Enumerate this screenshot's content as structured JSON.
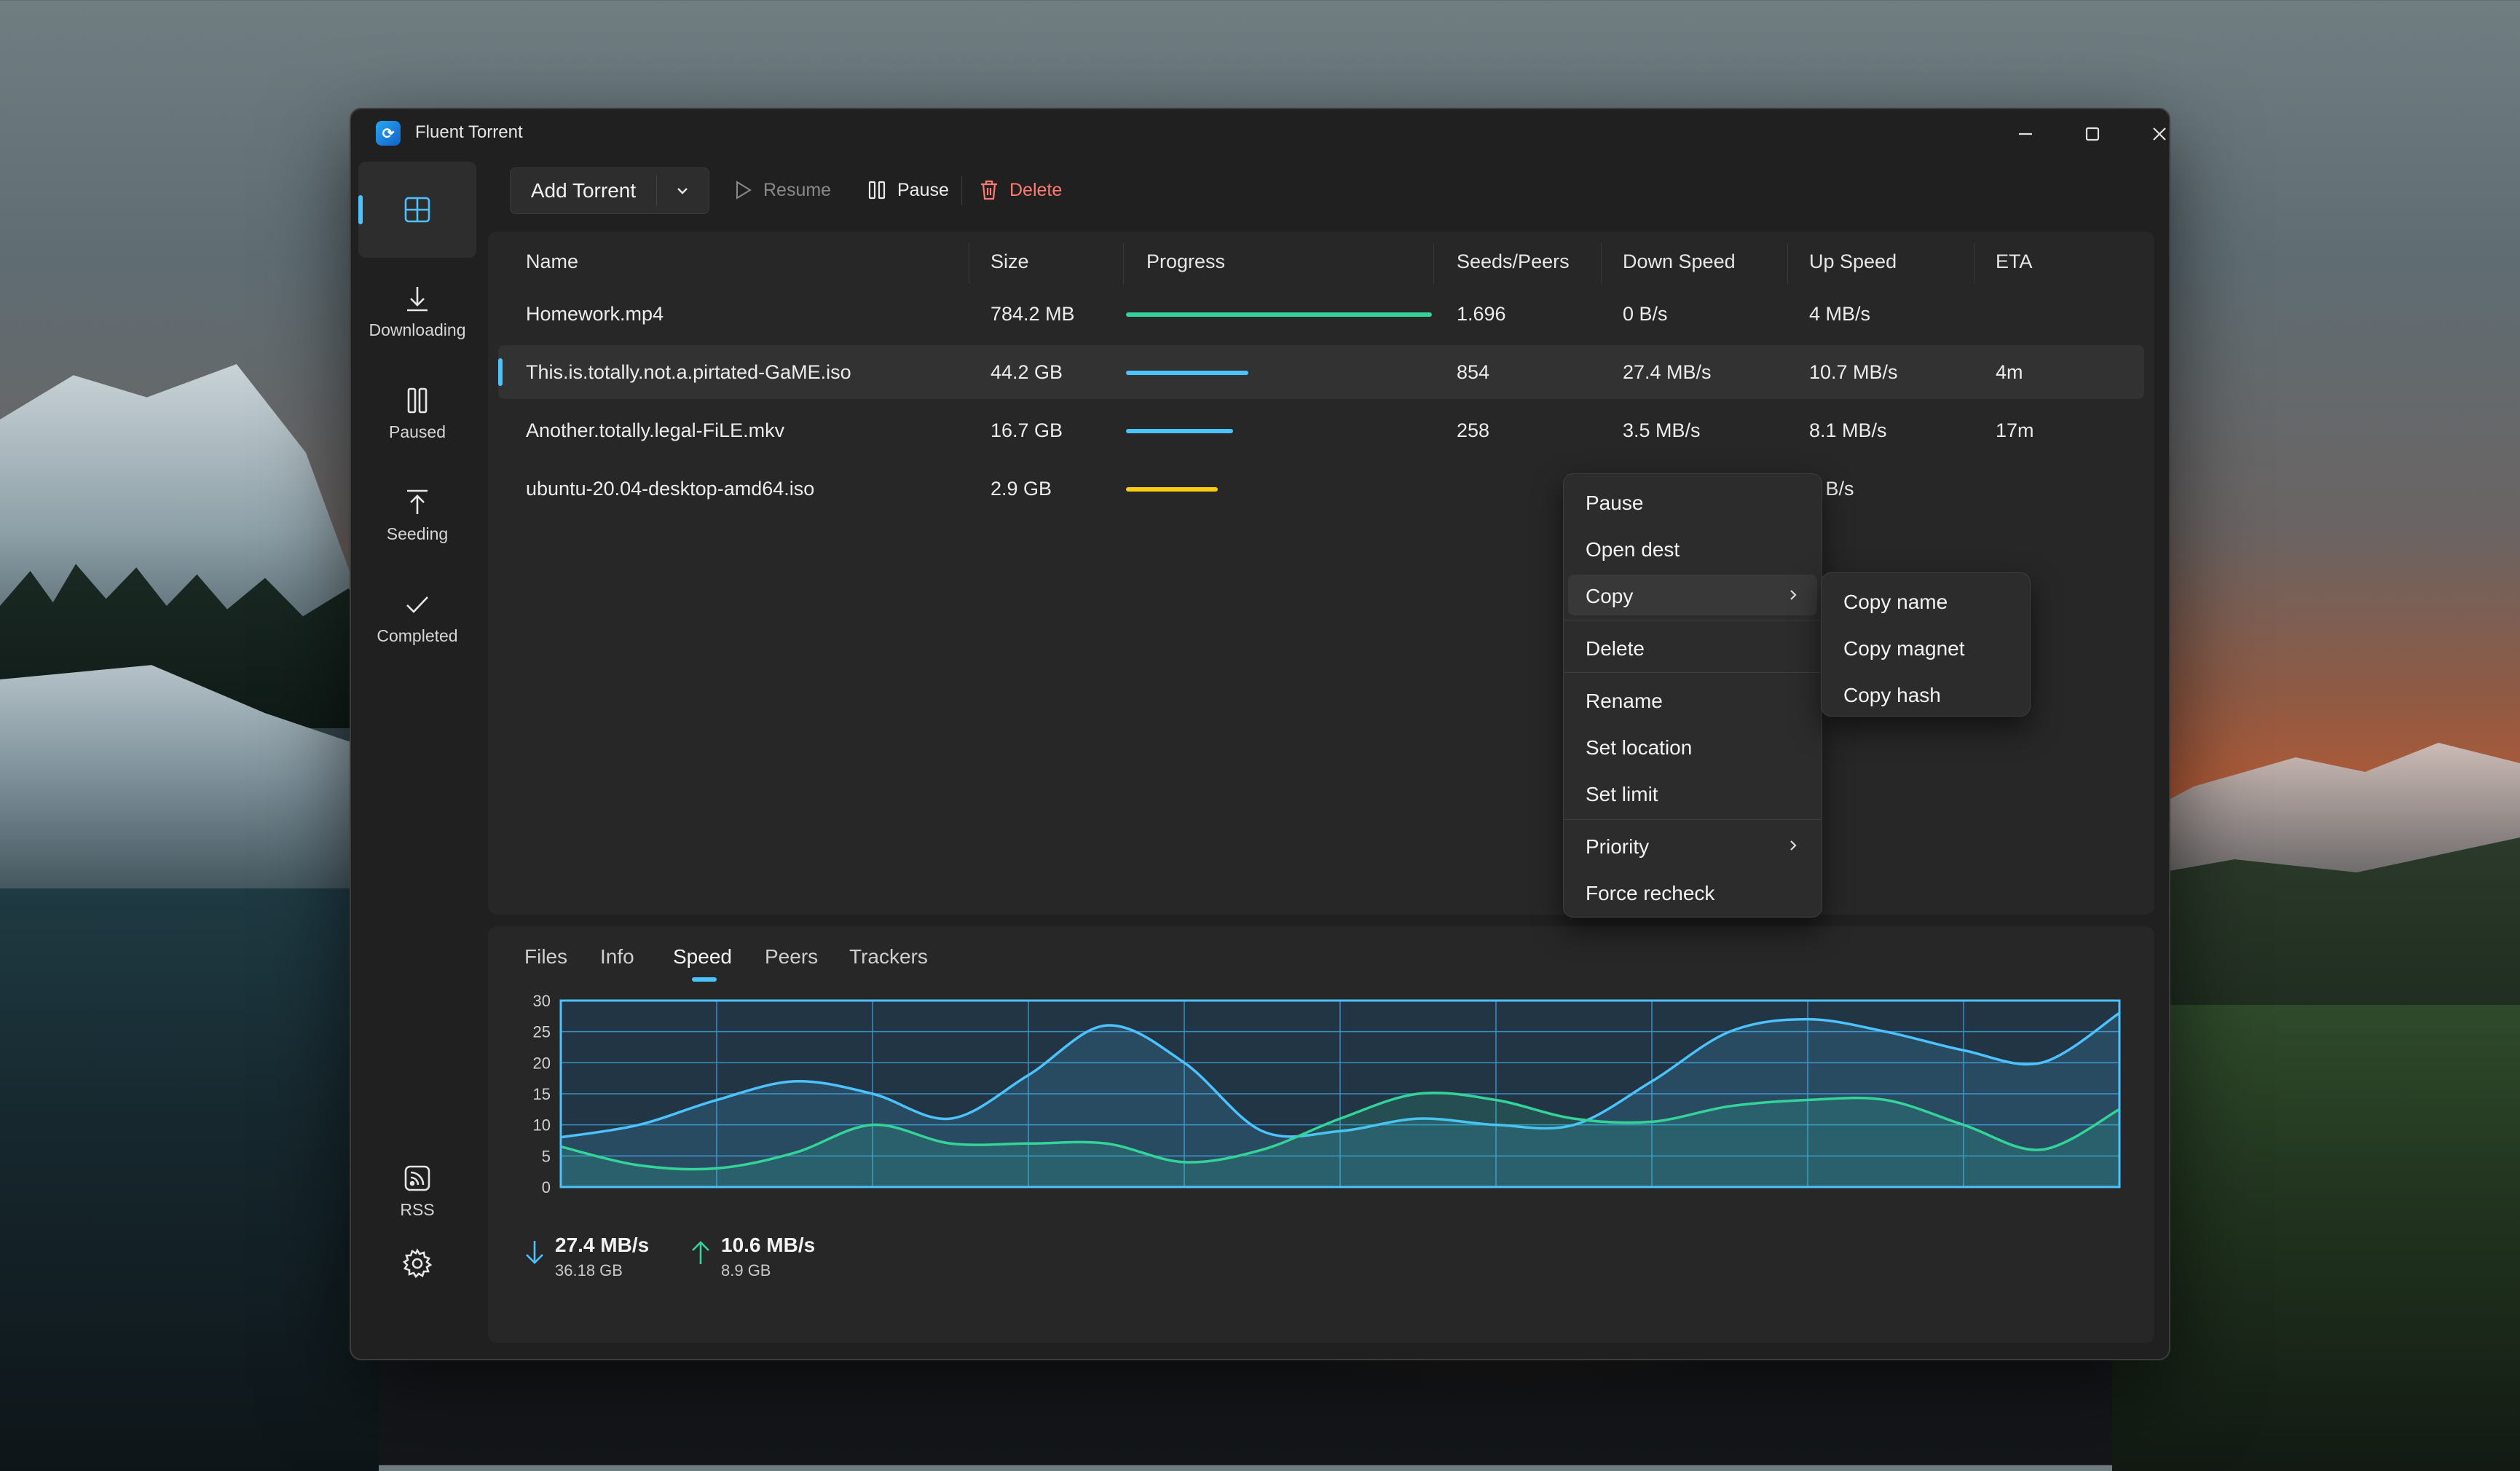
{
  "window": {
    "title": "Fluent Torrent"
  },
  "sidebar": {
    "items": [
      {
        "label": "",
        "icon": "grid-icon"
      },
      {
        "label": "Downloading",
        "icon": "download-icon"
      },
      {
        "label": "Paused",
        "icon": "pause-icon"
      },
      {
        "label": "Seeding",
        "icon": "upload-icon"
      },
      {
        "label": "Completed",
        "icon": "checkmark-icon"
      }
    ],
    "rss_label": "RSS",
    "settings_icon": "gear-icon"
  },
  "toolbar": {
    "add_torrent": "Add Torrent",
    "resume": "Resume",
    "pause": "Pause",
    "delete": "Delete"
  },
  "table": {
    "columns": [
      "Name",
      "Size",
      "Progress",
      "Seeds/Peers",
      "Down Speed",
      "Up Speed",
      "ETA"
    ],
    "rows": [
      {
        "name": "Homework.mp4",
        "size": "784.2 MB",
        "progress": 1.0,
        "color": "#34d399",
        "seeds_peers": "1.696",
        "down": "0 B/s",
        "up": "4 MB/s",
        "eta": ""
      },
      {
        "name": "This.is.totally.not.a.pirtated-GaME.iso",
        "size": "44.2 GB",
        "progress": 0.4,
        "color": "#4cc2ff",
        "seeds_peers": "854",
        "down": "27.4 MB/s",
        "up": "10.7 MB/s",
        "eta": "4m"
      },
      {
        "name": "Another.totally.legal-FiLE.mkv",
        "size": "16.7 GB",
        "progress": 0.35,
        "color": "#4cc2ff",
        "seeds_peers": "258",
        "down": "3.5 MB/s",
        "up": "8.1 MB/s",
        "eta": "17m"
      },
      {
        "name": "ubuntu-20.04-desktop-amd64.iso",
        "size": "2.9 GB",
        "progress": 0.3,
        "color": "#facc15",
        "seeds_peers": "",
        "down": "",
        "up": "0 B/s",
        "eta": ""
      }
    ]
  },
  "context_menu": {
    "items": [
      "Pause",
      "Open dest",
      "Copy",
      "Delete",
      "Rename",
      "Set location",
      "Set limit",
      "Priority",
      "Force recheck"
    ],
    "copy_submenu": [
      "Copy name",
      "Copy magnet",
      "Copy hash"
    ]
  },
  "details": {
    "tabs": [
      "Files",
      "Info",
      "Speed",
      "Peers",
      "Trackers"
    ],
    "active_tab": "Speed",
    "download": {
      "speed": "27.4 MB/s",
      "total": "36.18 GB"
    },
    "upload": {
      "speed": "10.6 MB/s",
      "total": "8.9 GB"
    }
  },
  "chart_data": {
    "type": "area",
    "ylim": [
      0,
      30
    ],
    "yticks": [
      0,
      5,
      10,
      15,
      20,
      25,
      30
    ],
    "x": [
      0,
      0.5,
      1,
      1.5,
      2,
      2.5,
      3,
      3.5,
      4,
      4.5,
      5,
      5.5,
      6,
      6.5,
      7,
      7.5,
      8,
      8.5,
      9,
      9.5,
      10
    ],
    "series": [
      {
        "color": "#4cc2ff",
        "values": [
          8,
          10,
          14,
          17,
          15,
          11,
          18,
          26,
          20,
          9,
          9,
          11,
          10,
          10,
          17,
          25,
          27,
          25,
          22,
          20,
          28
        ]
      },
      {
        "color": "#34d399",
        "values": [
          6.5,
          3.5,
          3,
          5.5,
          10,
          7,
          7,
          7,
          4,
          6,
          11,
          15,
          14,
          11,
          10.5,
          13,
          14,
          14,
          10,
          6,
          12.5
        ]
      }
    ],
    "colors": {
      "grid": "#3a8fc0",
      "border": "#4cc2ff"
    }
  }
}
